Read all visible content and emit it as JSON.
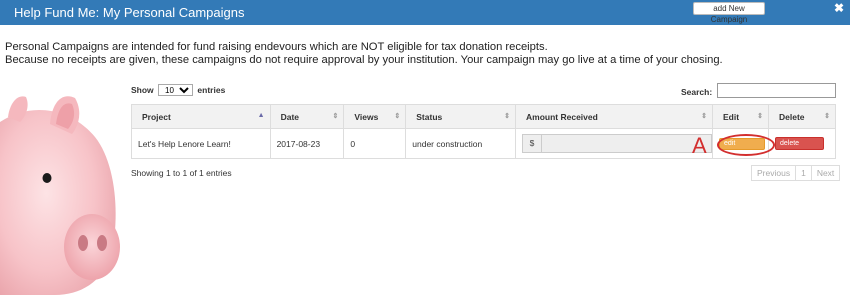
{
  "window": {
    "title": "Help Fund Me: My Personal Campaigns",
    "add_button": "add New Campaign",
    "close_glyph": "✖"
  },
  "intro": {
    "line1": "Personal Campaigns are intended for fund raising endevours which are NOT eligible for tax donation receipts.",
    "line2": "Because no receipts are given, these campaigns do not require approval by your institution. Your campaign may go live at a time of your chosing."
  },
  "table_controls": {
    "show_label": "Show",
    "page_length": "10",
    "entries_label": "entries",
    "search_label": "Search:",
    "search_value": ""
  },
  "table": {
    "headers": [
      "Project",
      "Date",
      "Views",
      "Status",
      "Amount Received",
      "Edit",
      "Delete"
    ],
    "rows": [
      {
        "project": "Let's Help Lenore Learn!",
        "date": "2017-08-23",
        "views": "0",
        "status": "under construction",
        "currency": "$",
        "amount": "",
        "edit_label": "edit",
        "delete_label": "delete"
      }
    ]
  },
  "annotation": {
    "letter": "A",
    "color": "#d32f2f"
  },
  "info": "Showing 1 to 1 of 1 entries",
  "pagination": {
    "previous": "Previous",
    "page": "1",
    "next": "Next"
  },
  "colors": {
    "header_bar": "#337ab7",
    "edit": "#f0ad4e",
    "delete": "#d9534f"
  }
}
